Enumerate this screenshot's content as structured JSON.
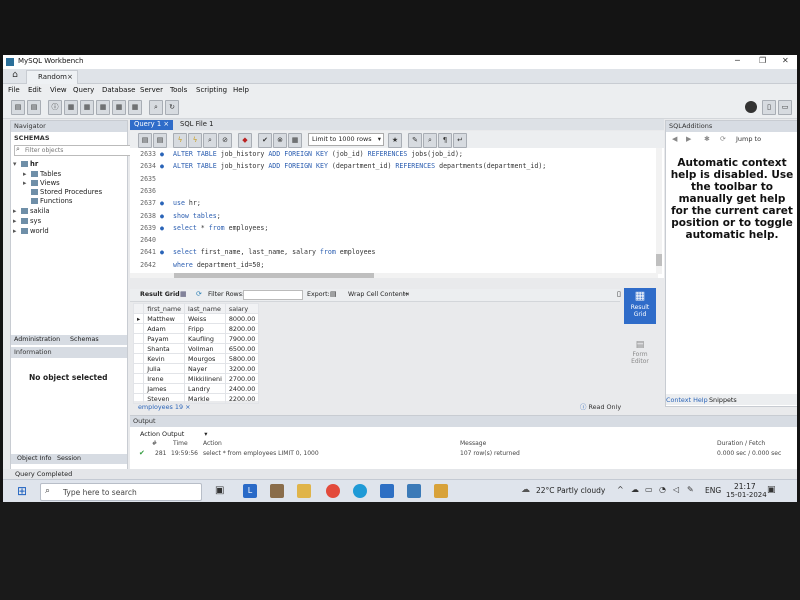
{
  "window": {
    "title": "MySQL Workbench"
  },
  "connection_tab": {
    "label": "Random",
    "close": "×"
  },
  "menu": [
    "File",
    "Edit",
    "View",
    "Query",
    "Database",
    "Server",
    "Tools",
    "Scripting",
    "Help"
  ],
  "navigator": {
    "title": "Navigator",
    "schemas_label": "SCHEMAS",
    "filter_placeholder": "Filter objects",
    "schemas": [
      {
        "name": "hr",
        "expanded": true,
        "children": [
          "Tables",
          "Views",
          "Stored Procedures",
          "Functions"
        ]
      },
      {
        "name": "sakila"
      },
      {
        "name": "sys"
      },
      {
        "name": "world"
      }
    ],
    "tabs": [
      "Administration",
      "Schemas"
    ],
    "info_title": "Information",
    "no_object": "No object selected",
    "bottom_tabs": [
      "Object Info",
      "Session"
    ]
  },
  "editor": {
    "tabs": [
      "Query 1",
      "SQL File 1"
    ],
    "limit": "Limit to 1000 rows",
    "lines": [
      {
        "n": "2633",
        "dot": true,
        "code": "ALTER TABLE job_history ADD FOREIGN KEY (job_id) REFERENCES jobs(job_id);"
      },
      {
        "n": "2634",
        "dot": true,
        "code": "ALTER TABLE job_history ADD FOREIGN KEY (department_id) REFERENCES departments(department_id);"
      },
      {
        "n": "2635",
        "dot": false,
        "code": ""
      },
      {
        "n": "2636",
        "dot": false,
        "code": ""
      },
      {
        "n": "2637",
        "dot": true,
        "code": "use hr;"
      },
      {
        "n": "2638",
        "dot": true,
        "code": "show tables;"
      },
      {
        "n": "2639",
        "dot": true,
        "code": "select * from employees;"
      },
      {
        "n": "2640",
        "dot": false,
        "code": ""
      },
      {
        "n": "2641",
        "dot": true,
        "code": "select first_name, last_name, salary from employees"
      },
      {
        "n": "2642",
        "dot": false,
        "code": "where department_id=50;"
      }
    ]
  },
  "result": {
    "toolbar": {
      "grid": "Result Grid",
      "filter": "Filter Rows:",
      "export": "Export:",
      "wrap": "Wrap Cell Content:"
    },
    "columns": [
      "first_name",
      "last_name",
      "salary"
    ],
    "rows": [
      [
        "Matthew",
        "Weiss",
        "8000.00"
      ],
      [
        "Adam",
        "Fripp",
        "8200.00"
      ],
      [
        "Payam",
        "Kaufling",
        "7900.00"
      ],
      [
        "Shanta",
        "Vollman",
        "6500.00"
      ],
      [
        "Kevin",
        "Mourgos",
        "5800.00"
      ],
      [
        "Julia",
        "Nayer",
        "3200.00"
      ],
      [
        "Irene",
        "Mikkilineni",
        "2700.00"
      ],
      [
        "James",
        "Landry",
        "2400.00"
      ],
      [
        "Steven",
        "Markle",
        "2200.00"
      ]
    ],
    "tab_label": "employees 19",
    "read_only": "Read Only",
    "side_grid": "Result Grid",
    "side_form": "Form Editor"
  },
  "sql_additions": {
    "title": "SQLAdditions",
    "jump_to": "Jump to",
    "help_text": "Automatic context help is disabled. Use the toolbar to manually get help for the current caret position or to toggle automatic help.",
    "tabs": [
      "Context Help",
      "Snippets"
    ]
  },
  "output": {
    "title": "Output",
    "mode": "Action Output",
    "headers": {
      "num": "#",
      "time": "Time",
      "action": "Action",
      "message": "Message",
      "duration": "Duration / Fetch"
    },
    "row": {
      "num": "281",
      "time": "19:59:56",
      "action": "select * from employees LIMIT 0, 1000",
      "message": "107 row(s) returned",
      "duration": "0.000 sec / 0.000 sec"
    }
  },
  "status": "Query Completed",
  "taskbar": {
    "search_placeholder": "Type here to search",
    "weather": "22°C  Partly cloudy",
    "lang": "ENG",
    "time": "21:17",
    "date": "15-01-2024"
  },
  "colors": {
    "accent": "#2f6cc9",
    "keyword": "#2a5db0"
  }
}
